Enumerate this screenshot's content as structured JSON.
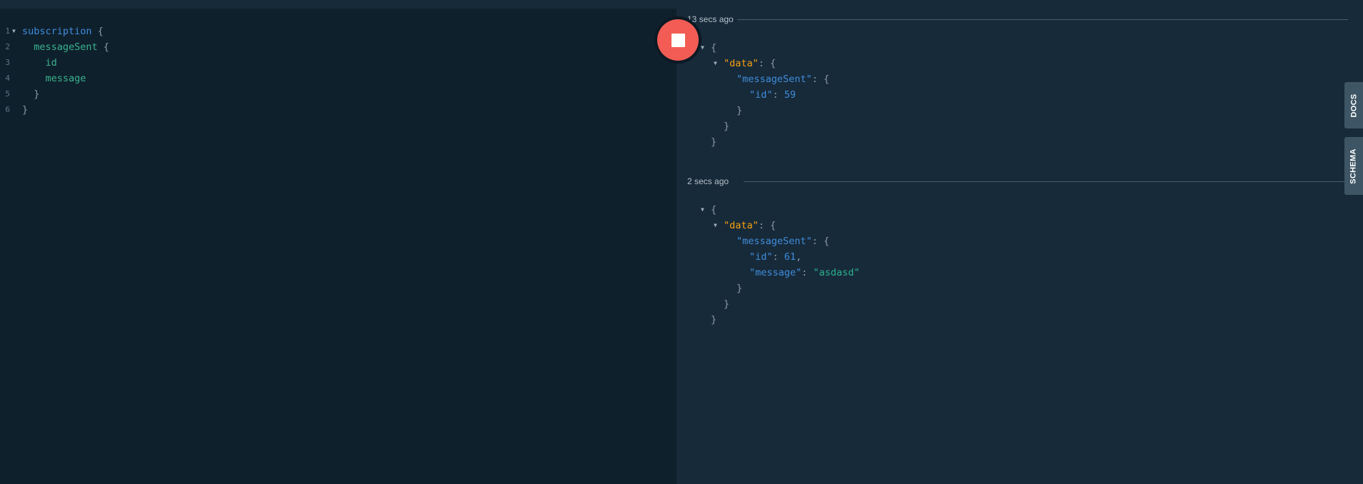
{
  "editor": {
    "lines": [
      {
        "number": "1",
        "foldable": true,
        "fold_icon": "caret-down-icon",
        "indent": "",
        "parts": [
          {
            "cls": "kw",
            "text": "subscription"
          },
          {
            "cls": "punct",
            "text": " {"
          }
        ]
      },
      {
        "number": "2",
        "foldable": false,
        "indent": "  ",
        "parts": [
          {
            "cls": "field",
            "text": "messageSent"
          },
          {
            "cls": "punct",
            "text": " {"
          }
        ]
      },
      {
        "number": "3",
        "foldable": false,
        "indent": "    ",
        "parts": [
          {
            "cls": "field",
            "text": "id"
          }
        ]
      },
      {
        "number": "4",
        "foldable": false,
        "indent": "    ",
        "parts": [
          {
            "cls": "field",
            "text": "message"
          }
        ]
      },
      {
        "number": "5",
        "foldable": false,
        "indent": "  ",
        "parts": [
          {
            "cls": "punct",
            "text": "}"
          }
        ]
      },
      {
        "number": "6",
        "foldable": false,
        "indent": "",
        "parts": [
          {
            "cls": "punct",
            "text": "}"
          }
        ]
      }
    ]
  },
  "run_control": {
    "icon": "stop-icon",
    "color": "#f25c54"
  },
  "results": [
    {
      "timestamp": "13 secs ago",
      "lines": [
        {
          "foldable": true,
          "indent": 0,
          "parts": [
            {
              "cls": "jpunct",
              "text": "{"
            }
          ]
        },
        {
          "foldable": true,
          "indent": 1,
          "parts": [
            {
              "cls": "jkey-data",
              "text": "\"data\""
            },
            {
              "cls": "jpunct",
              "text": ": {"
            }
          ]
        },
        {
          "foldable": false,
          "indent": 2,
          "parts": [
            {
              "cls": "jkey",
              "text": "\"messageSent\""
            },
            {
              "cls": "jpunct",
              "text": ": {"
            }
          ]
        },
        {
          "foldable": false,
          "indent": 3,
          "parts": [
            {
              "cls": "jkey",
              "text": "\"id\""
            },
            {
              "cls": "jpunct",
              "text": ": "
            },
            {
              "cls": "jnum",
              "text": "59"
            }
          ]
        },
        {
          "foldable": false,
          "indent": 2,
          "parts": [
            {
              "cls": "jpunct",
              "text": "}"
            }
          ]
        },
        {
          "foldable": false,
          "indent": 1,
          "parts": [
            {
              "cls": "jpunct",
              "text": "}"
            }
          ]
        },
        {
          "foldable": false,
          "indent": 0,
          "parts": [
            {
              "cls": "jpunct",
              "text": "}"
            }
          ]
        }
      ]
    },
    {
      "timestamp": "2 secs ago",
      "lines": [
        {
          "foldable": true,
          "indent": 0,
          "parts": [
            {
              "cls": "jpunct",
              "text": "{"
            }
          ]
        },
        {
          "foldable": true,
          "indent": 1,
          "parts": [
            {
              "cls": "jkey-data",
              "text": "\"data\""
            },
            {
              "cls": "jpunct",
              "text": ": {"
            }
          ]
        },
        {
          "foldable": false,
          "indent": 2,
          "parts": [
            {
              "cls": "jkey",
              "text": "\"messageSent\""
            },
            {
              "cls": "jpunct",
              "text": ": {"
            }
          ]
        },
        {
          "foldable": false,
          "indent": 3,
          "parts": [
            {
              "cls": "jkey",
              "text": "\"id\""
            },
            {
              "cls": "jpunct",
              "text": ": "
            },
            {
              "cls": "jnum",
              "text": "61"
            },
            {
              "cls": "jpunct",
              "text": ","
            }
          ]
        },
        {
          "foldable": false,
          "indent": 3,
          "parts": [
            {
              "cls": "jkey",
              "text": "\"message\""
            },
            {
              "cls": "jpunct",
              "text": ": "
            },
            {
              "cls": "jstr",
              "text": "\"asdasd\""
            }
          ]
        },
        {
          "foldable": false,
          "indent": 2,
          "parts": [
            {
              "cls": "jpunct",
              "text": "}"
            }
          ]
        },
        {
          "foldable": false,
          "indent": 1,
          "parts": [
            {
              "cls": "jpunct",
              "text": "}"
            }
          ]
        },
        {
          "foldable": false,
          "indent": 0,
          "parts": [
            {
              "cls": "jpunct",
              "text": "}"
            }
          ]
        }
      ]
    }
  ],
  "side_tabs": {
    "docs": "DOCS",
    "schema": "SCHEMA"
  }
}
